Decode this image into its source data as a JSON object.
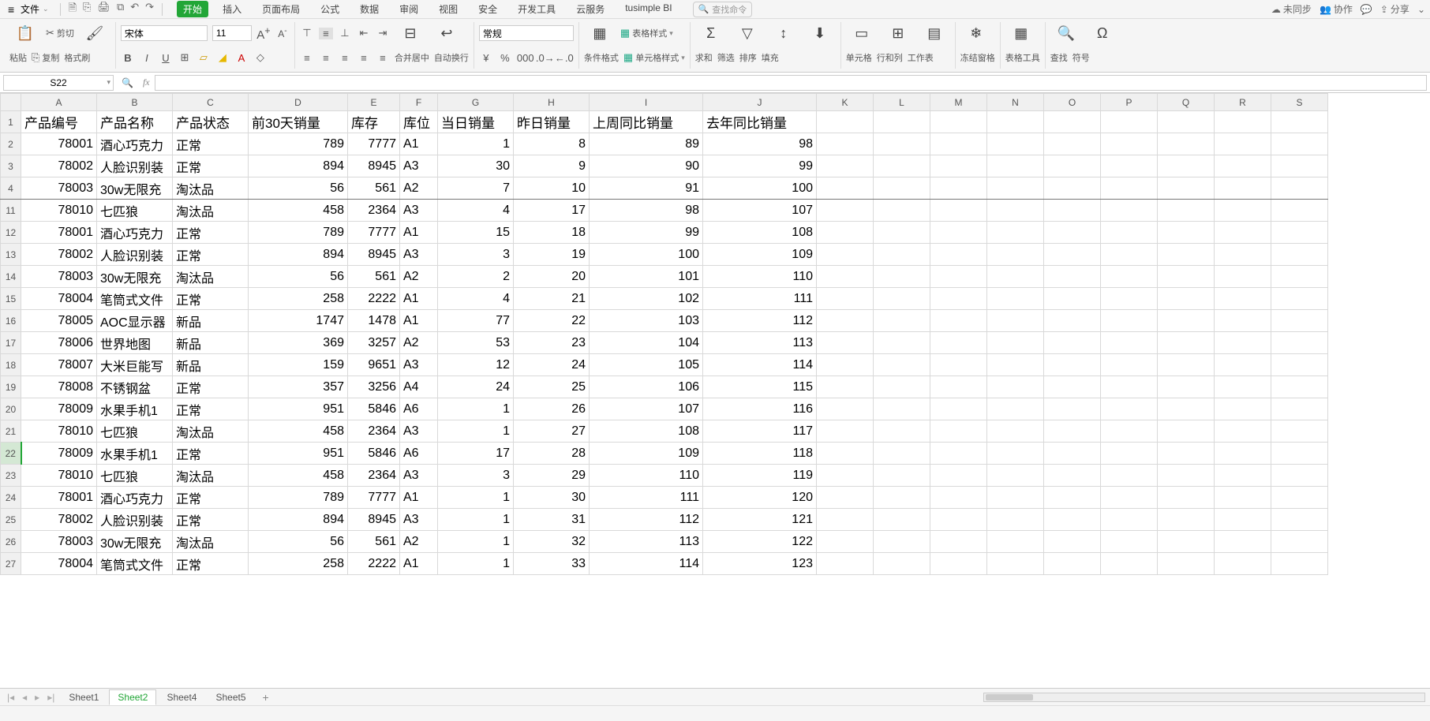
{
  "menu": {
    "file": "文件",
    "quick_icons": [
      "🗎",
      "⎘",
      "🖨",
      "⧉",
      "↶",
      "↷"
    ],
    "tabs": [
      "开始",
      "插入",
      "页面布局",
      "公式",
      "数据",
      "审阅",
      "视图",
      "安全",
      "开发工具",
      "云服务",
      "tusimple BI"
    ],
    "active_tab_index": 0,
    "search_placeholder": "查找命令",
    "right": {
      "sync": "未同步",
      "collab": "协作",
      "chat": "",
      "share": "分享"
    }
  },
  "ribbon": {
    "paste": {
      "cut": "剪切",
      "copy": "复制",
      "paste": "粘贴",
      "format_painter": "格式刷"
    },
    "font": {
      "name": "宋体",
      "size": "11",
      "grow": "A",
      "shrink": "A"
    },
    "align": {
      "merge_center": "合并居中",
      "wrap": "自动换行"
    },
    "number": {
      "format": "常规"
    },
    "styles": {
      "cond": "条件格式",
      "table_style": "表格样式",
      "cell_style": "单元格样式"
    },
    "editing": {
      "sum": "求和",
      "filter": "筛选",
      "sort": "排序",
      "fill": "填充"
    },
    "cells": {
      "cell": "单元格",
      "rowcol": "行和列",
      "worksheet": "工作表"
    },
    "view": {
      "freeze": "冻结窗格",
      "tools": "表格工具",
      "find": "查找",
      "symbol": "符号"
    }
  },
  "namebox": "S22",
  "formula": "",
  "columns": [
    "A",
    "B",
    "C",
    "D",
    "E",
    "F",
    "G",
    "H",
    "I",
    "J",
    "K",
    "L",
    "M",
    "N",
    "O",
    "P",
    "Q"
  ],
  "headers": [
    "产品编号",
    "产品名称",
    "产品状态",
    "前30天销量",
    "库存",
    "库位",
    "当日销量",
    "昨日销量",
    "上周同比销量",
    "去年同比销量"
  ],
  "rows": [
    {
      "n": 2,
      "c": [
        "78001",
        "酒心巧克力",
        "正常",
        "789",
        "7777",
        "A1",
        "1",
        "8",
        "89",
        "98"
      ]
    },
    {
      "n": 3,
      "c": [
        "78002",
        "人脸识别装",
        "正常",
        "894",
        "8945",
        "A3",
        "30",
        "9",
        "90",
        "99"
      ]
    },
    {
      "n": 4,
      "c": [
        "78003",
        "30w无限充",
        "淘汰品",
        "56",
        "561",
        "A2",
        "7",
        "10",
        "91",
        "100"
      ],
      "frozen_edge": true
    },
    {
      "n": 11,
      "c": [
        "78010",
        "七匹狼",
        "淘汰品",
        "458",
        "2364",
        "A3",
        "4",
        "17",
        "98",
        "107"
      ]
    },
    {
      "n": 12,
      "c": [
        "78001",
        "酒心巧克力",
        "正常",
        "789",
        "7777",
        "A1",
        "15",
        "18",
        "99",
        "108"
      ]
    },
    {
      "n": 13,
      "c": [
        "78002",
        "人脸识别装",
        "正常",
        "894",
        "8945",
        "A3",
        "3",
        "19",
        "100",
        "109"
      ]
    },
    {
      "n": 14,
      "c": [
        "78003",
        "30w无限充",
        "淘汰品",
        "56",
        "561",
        "A2",
        "2",
        "20",
        "101",
        "110"
      ]
    },
    {
      "n": 15,
      "c": [
        "78004",
        "笔筒式文件",
        "正常",
        "258",
        "2222",
        "A1",
        "4",
        "21",
        "102",
        "111"
      ]
    },
    {
      "n": 16,
      "c": [
        "78005",
        "AOC显示器",
        "新品",
        "1747",
        "1478",
        "A1",
        "77",
        "22",
        "103",
        "112"
      ]
    },
    {
      "n": 17,
      "c": [
        "78006",
        "世界地图",
        "新品",
        "369",
        "3257",
        "A2",
        "53",
        "23",
        "104",
        "113"
      ]
    },
    {
      "n": 18,
      "c": [
        "78007",
        "大米巨能写",
        "新品",
        "159",
        "9651",
        "A3",
        "12",
        "24",
        "105",
        "114"
      ]
    },
    {
      "n": 19,
      "c": [
        "78008",
        "不锈钢盆",
        "正常",
        "357",
        "3256",
        "A4",
        "24",
        "25",
        "106",
        "115"
      ]
    },
    {
      "n": 20,
      "c": [
        "78009",
        "水果手机1",
        "正常",
        "951",
        "5846",
        "A6",
        "1",
        "26",
        "107",
        "116"
      ]
    },
    {
      "n": 21,
      "c": [
        "78010",
        "七匹狼",
        "淘汰品",
        "458",
        "2364",
        "A3",
        "1",
        "27",
        "108",
        "117"
      ]
    },
    {
      "n": 22,
      "c": [
        "78009",
        "水果手机1",
        "正常",
        "951",
        "5846",
        "A6",
        "17",
        "28",
        "109",
        "118"
      ],
      "selected_row": true
    },
    {
      "n": 23,
      "c": [
        "78010",
        "七匹狼",
        "淘汰品",
        "458",
        "2364",
        "A3",
        "3",
        "29",
        "110",
        "119"
      ]
    },
    {
      "n": 24,
      "c": [
        "78001",
        "酒心巧克力",
        "正常",
        "789",
        "7777",
        "A1",
        "1",
        "30",
        "111",
        "120"
      ]
    },
    {
      "n": 25,
      "c": [
        "78002",
        "人脸识别装",
        "正常",
        "894",
        "8945",
        "A3",
        "1",
        "31",
        "112",
        "121"
      ]
    },
    {
      "n": 26,
      "c": [
        "78003",
        "30w无限充",
        "淘汰品",
        "56",
        "561",
        "A2",
        "1",
        "32",
        "113",
        "122"
      ]
    },
    {
      "n": 27,
      "c": [
        "78004",
        "笔筒式文件",
        "正常",
        "258",
        "2222",
        "A1",
        "1",
        "33",
        "114",
        "123"
      ]
    }
  ],
  "sheets": {
    "list": [
      "Sheet1",
      "Sheet2",
      "Sheet4",
      "Sheet5"
    ],
    "active_index": 1
  }
}
